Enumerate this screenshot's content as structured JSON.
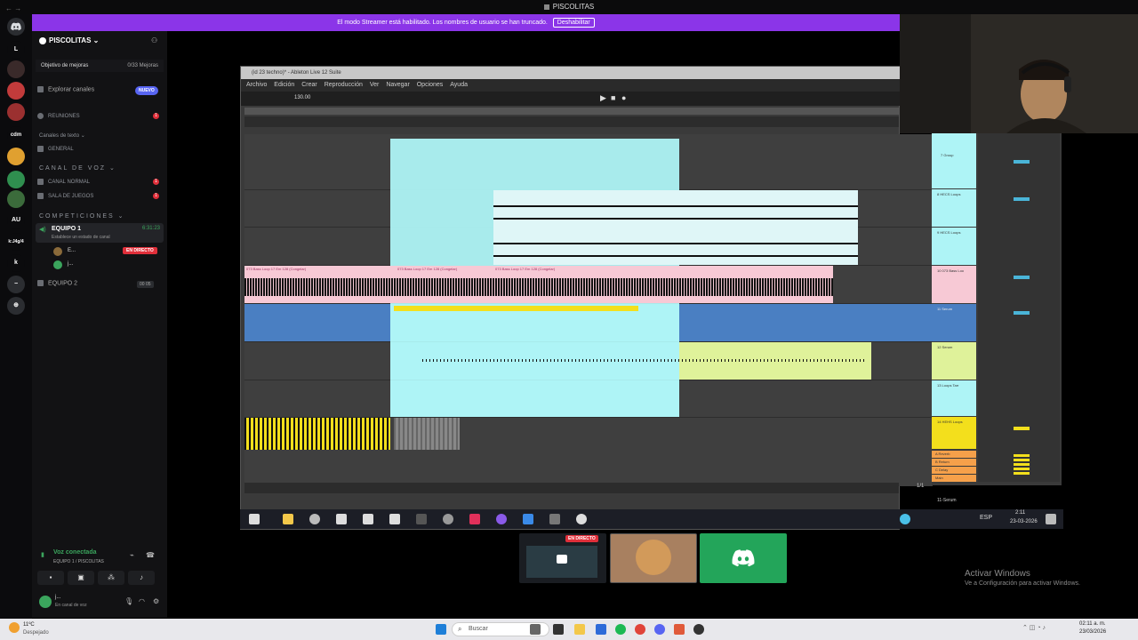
{
  "window": {
    "title": "PISCOLITAS"
  },
  "banner": {
    "text": "El modo Streamer está habilitado. Los nombres de usuario se han truncado.",
    "button": "Deshabilitar"
  },
  "rail": {
    "items": [
      "L",
      "cdm",
      "AU",
      "k",
      "k"
    ],
    "labels": [
      "k:J4g/4"
    ]
  },
  "sidebar": {
    "server_name": "PISCOLITAS",
    "boost_goal": "Objetivo de mejoras",
    "boost_count": "0/33 Mejoras",
    "explore": "Explorar canales",
    "new_badge": "NUEVO",
    "reuniones": "REUNIONES",
    "text_channels_header": "Canales de texto",
    "general": "GENERAL",
    "voice_category": "CANAL DE VOZ",
    "canal_normal": "CANAL NORMAL",
    "sala_juegos": "SALA DE JUEGOS",
    "competiciones": "COMPETICIONES",
    "equipo1": "EQUIPO 1",
    "equipo1_time": "6:31:23",
    "equipo1_status": "Establece un estado de canal",
    "live_badge": "EN DIRECTO",
    "member1": "E...",
    "member2": "j...",
    "equipo2": "EQUIPO 2",
    "equipo2_count": "00 05",
    "badge_count": "1"
  },
  "voice_panel": {
    "title": "Voz conectada",
    "subtitle": "EQUIPO 1 / PISCOLITAS",
    "user": "j...",
    "user_status": "En canal de voz"
  },
  "ableton": {
    "title": "(id 23 techno)* - Ableton Live 12 Suite",
    "menu": [
      "Archivo",
      "Edición",
      "Crear",
      "Reproducción",
      "Ver",
      "Navegar",
      "Opciones",
      "Ayuda"
    ],
    "tempo": "130.00",
    "clip_labels": [
      "073 Bass Loop 17 Em 128 (Congelar)",
      "073 Bass Loop 17 Em 128 (Congelar)",
      "073 Bass Loop 17 Em 128 (Congelar)"
    ],
    "track_names": [
      "7 Group",
      "8 HECS Loops",
      "9 HECS Loops",
      "10 073 Bass Loo",
      "11 Serum",
      "12 Serum",
      "13 Loops Tarr",
      "14 HEHS Loops"
    ],
    "returns": [
      "A Reverb",
      "B Return",
      "C Delay",
      "Main"
    ],
    "footer_left": "1/1",
    "footer_right": "11-Serum",
    "clock": "2:11",
    "date": "23-03-2026",
    "lang": "ESP"
  },
  "stream_tiles": {
    "live_badge": "EN DIRECTO"
  },
  "activate": {
    "title": "Activar Windows",
    "subtitle": "Ve a Configuración para activar Windows."
  },
  "os_taskbar": {
    "weather_temp": "11ºC",
    "weather_desc": "Despejado",
    "search": "Buscar",
    "clock": "02:11 a. m.",
    "date": "23/03/2026"
  },
  "colors": {
    "banner": "#8b35e8",
    "cyan_clip": "#aef4f6",
    "pink_clip": "#f7c9d5",
    "blue_track": "#4a7fc2",
    "lime_clip": "#dff29a",
    "yellow_clip": "#f3df1c",
    "discord_green": "#23a55a"
  }
}
